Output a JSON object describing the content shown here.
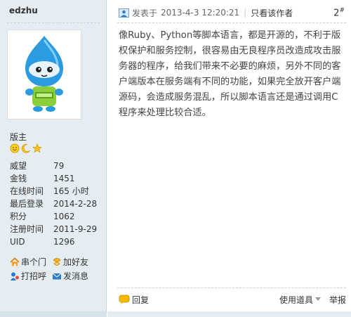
{
  "author": {
    "username": "edzhu",
    "role": "版主",
    "medals": [
      "smiley-medal",
      "moon-medal",
      "star-medal"
    ],
    "stats": [
      {
        "label": "威望",
        "value": "79"
      },
      {
        "label": "金钱",
        "value": "1451"
      },
      {
        "label": "在线时间",
        "value": "165 小时"
      },
      {
        "label": "最后登录",
        "value": "2014-2-28"
      },
      {
        "label": "积分",
        "value": "1062"
      },
      {
        "label": "注册时间",
        "value": "2011-9-29"
      },
      {
        "label": "UID",
        "value": "1296"
      }
    ],
    "actions": {
      "visit": "串个门",
      "add_friend": "加好友",
      "greet": "打招呼",
      "message": "发消息"
    }
  },
  "post": {
    "posted_prefix": "发表于",
    "timestamp": "2013-4-3 12:20:21",
    "only_author": "只看该作者",
    "floor_number": "2",
    "floor_suffix": "#",
    "body": "像Ruby、Python等脚本语言，都是开源的，不利于版权保护和服务控制，很容易由无良程序员改造成攻击服务器的程序，给我们带来不必要的麻烦，另外不同的客户端版本在服务端有不同的功能，如果完全放开客户端源码，会造成服务混乱，所以脚本语言还是通过调用C程序来处理比较合适。"
  },
  "footer": {
    "reply": "回复",
    "tools": "使用道具",
    "report": "举报"
  },
  "colors": {
    "sidebar_bg": "#e5edf2",
    "border": "#c2d5e3",
    "accent_blue": "#2b7acd",
    "reply_icon": "#f5b800"
  }
}
